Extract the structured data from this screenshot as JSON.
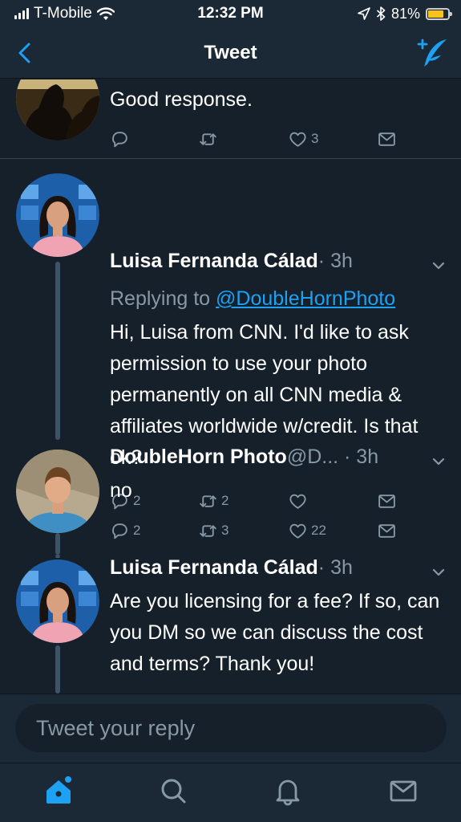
{
  "status_bar": {
    "carrier": "T-Mobile",
    "time": "12:32 PM",
    "battery": "81%",
    "battery_level": 0.81
  },
  "nav": {
    "title": "Tweet",
    "back_icon": "chevron-left-icon",
    "compose_icon": "compose-feather-icon"
  },
  "tweets": [
    {
      "body": "Good response.",
      "actions": {
        "replies": "",
        "retweets": "",
        "likes": "3"
      }
    },
    {
      "name": "Luisa Fernanda Cálad",
      "meta": " · 3h",
      "reply_prefix": "Replying to ",
      "reply_handle": "@DoubleHornPhoto",
      "body": "Hi, Luisa from CNN. I'd like to ask permission to use your photo permanently on all CNN media & affiliates worldwide w/credit. Is that ok?",
      "actions": {
        "replies": "2",
        "retweets": "2",
        "likes": ""
      }
    },
    {
      "name": "DoubleHorn Photo",
      "meta": " @D... · 3h",
      "body": "no",
      "actions": {
        "replies": "2",
        "retweets": "3",
        "likes": "22"
      }
    },
    {
      "name": "Luisa Fernanda Cálad",
      "meta": " · 3h",
      "body": "Are you licensing for a fee? If so, can you DM so we can discuss the cost and terms? Thank you!"
    }
  ],
  "composer": {
    "placeholder": "Tweet your reply"
  },
  "tab_bar": {
    "items": [
      "home-icon",
      "search-icon",
      "notifications-bell-icon",
      "messages-envelope-icon"
    ],
    "active": "home-icon"
  },
  "colors": {
    "background": "#15202b",
    "bar_background": "#1b2836",
    "accent": "#1da1f2",
    "secondary_text": "#8899a6",
    "battery": "#f7c21a"
  }
}
